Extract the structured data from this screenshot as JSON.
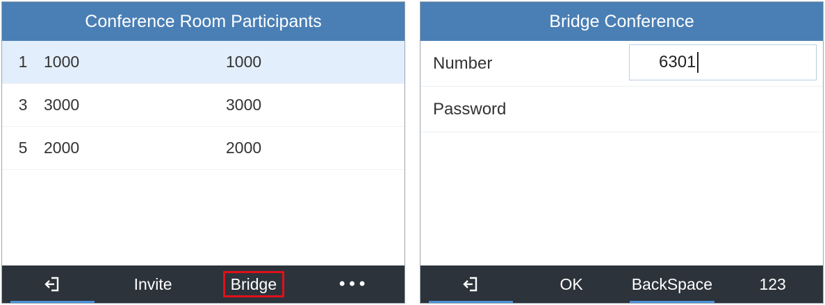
{
  "left_screen": {
    "title": "Conference Room Participants",
    "participants": [
      {
        "index": "1",
        "number": "1000",
        "name": "1000",
        "selected": true
      },
      {
        "index": "3",
        "number": "3000",
        "name": "3000",
        "selected": false
      },
      {
        "index": "5",
        "number": "2000",
        "name": "2000",
        "selected": false
      }
    ],
    "softkeys": {
      "exit_icon": "exit-icon",
      "invite": "Invite",
      "bridge": "Bridge",
      "more": "•••"
    }
  },
  "right_screen": {
    "title": "Bridge Conference",
    "number_label": "Number",
    "number_value": "6301",
    "password_label": "Password",
    "softkeys": {
      "exit_icon": "exit-icon",
      "ok": "OK",
      "backspace": "BackSpace",
      "input_mode": "123"
    }
  },
  "colors": {
    "titlebar": "#4a7fb5",
    "softkey_bar": "#2c333a",
    "selected_row": "#e3eefc",
    "highlight_box": "#e0101a"
  }
}
